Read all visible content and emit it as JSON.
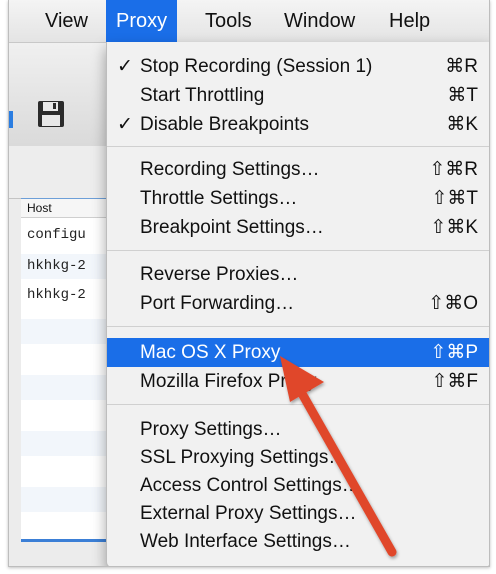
{
  "menubar": {
    "items": [
      {
        "label": "View"
      },
      {
        "label": "Proxy"
      },
      {
        "label": "Tools"
      },
      {
        "label": "Window"
      },
      {
        "label": "Help"
      }
    ]
  },
  "table": {
    "column_header": "Host",
    "rows": [
      "configu",
      "hkhkg-2",
      "hkhkg-2"
    ]
  },
  "proxy_menu": {
    "items": [
      {
        "check": "✓",
        "label": "Stop Recording (Session 1)",
        "shortcut": "⌘R"
      },
      {
        "check": "",
        "label": "Start Throttling",
        "shortcut": "⌘T"
      },
      {
        "check": "✓",
        "label": "Disable Breakpoints",
        "shortcut": "⌘K"
      },
      {
        "check": "",
        "label": "Recording Settings…",
        "shortcut": "⇧⌘R"
      },
      {
        "check": "",
        "label": "Throttle Settings…",
        "shortcut": "⇧⌘T"
      },
      {
        "check": "",
        "label": "Breakpoint Settings…",
        "shortcut": "⇧⌘K"
      },
      {
        "check": "",
        "label": "Reverse Proxies…",
        "shortcut": ""
      },
      {
        "check": "",
        "label": "Port Forwarding…",
        "shortcut": "⇧⌘O"
      },
      {
        "check": "",
        "label": "Mac OS X Proxy",
        "shortcut": "⇧⌘P"
      },
      {
        "check": "",
        "label": "Mozilla Firefox Proxy",
        "shortcut": "⇧⌘F"
      },
      {
        "check": "",
        "label": "Proxy Settings…",
        "shortcut": ""
      },
      {
        "check": "",
        "label": "SSL Proxying Settings…",
        "shortcut": ""
      },
      {
        "check": "",
        "label": "Access Control Settings…",
        "shortcut": ""
      },
      {
        "check": "",
        "label": "External Proxy Settings…",
        "shortcut": ""
      },
      {
        "check": "",
        "label": "Web Interface Settings…",
        "shortcut": ""
      }
    ]
  },
  "icons": {
    "save": "floppy-disk-icon",
    "annotation": "red-arrow-annotation"
  },
  "colors": {
    "highlight": "#1a6ee8",
    "annotation_arrow": "#e0462b"
  }
}
